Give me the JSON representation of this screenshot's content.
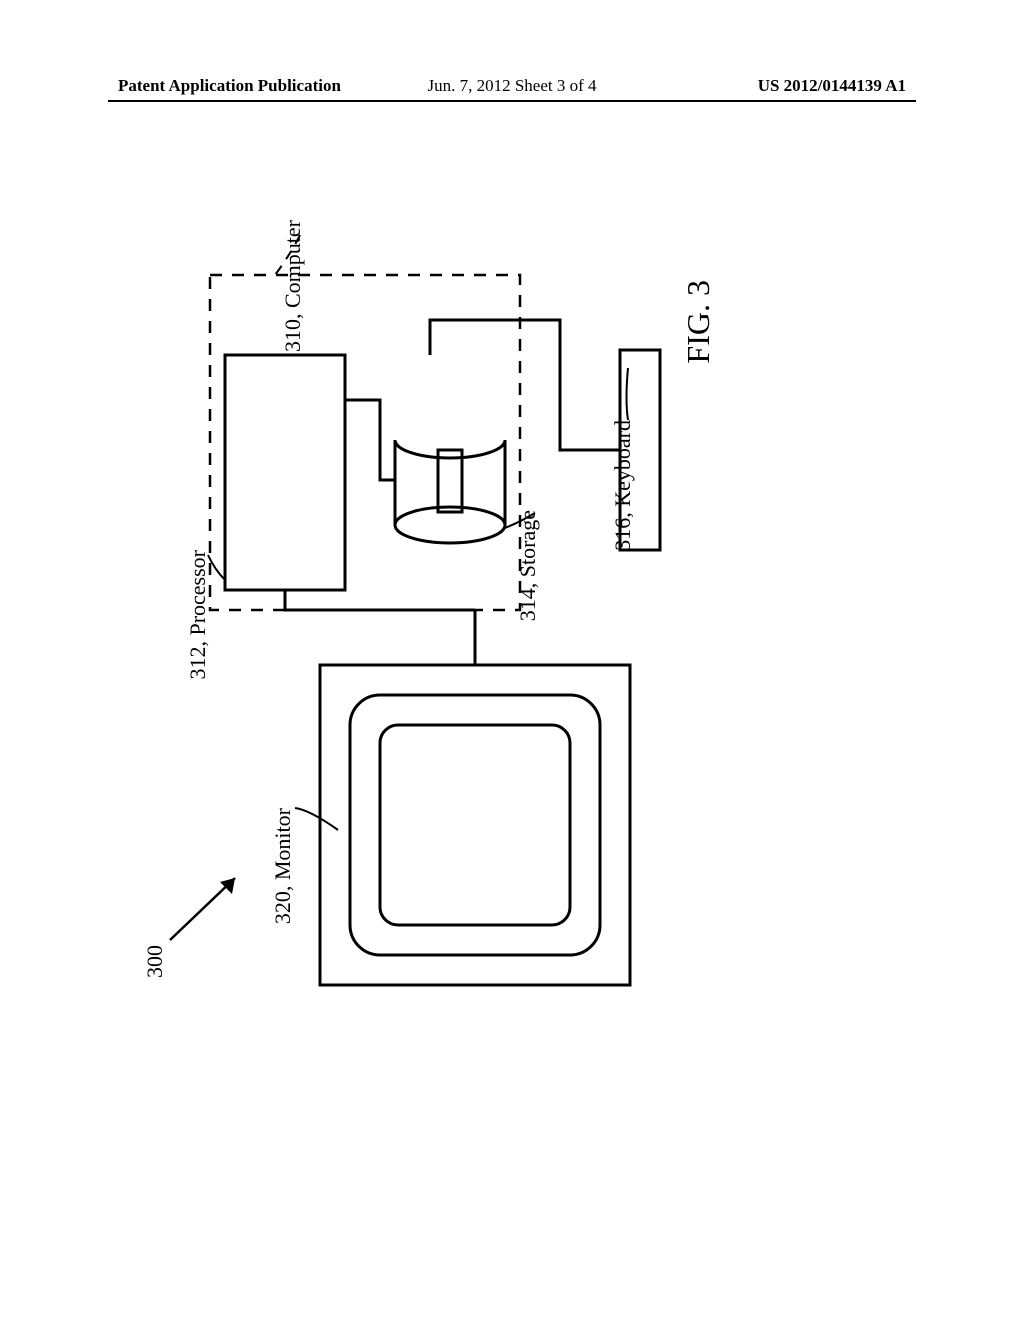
{
  "header": {
    "left": "Patent Application Publication",
    "center": "Jun. 7, 2012  Sheet 3 of 4",
    "right": "US 2012/0144139 A1"
  },
  "labels": {
    "system": "300",
    "monitor": "320, Monitor",
    "processor": "312, Processor",
    "storage": "314, Storage",
    "keyboard": "316, Keyboard",
    "computer": "310, Computer",
    "fig": "FIG. 3"
  }
}
